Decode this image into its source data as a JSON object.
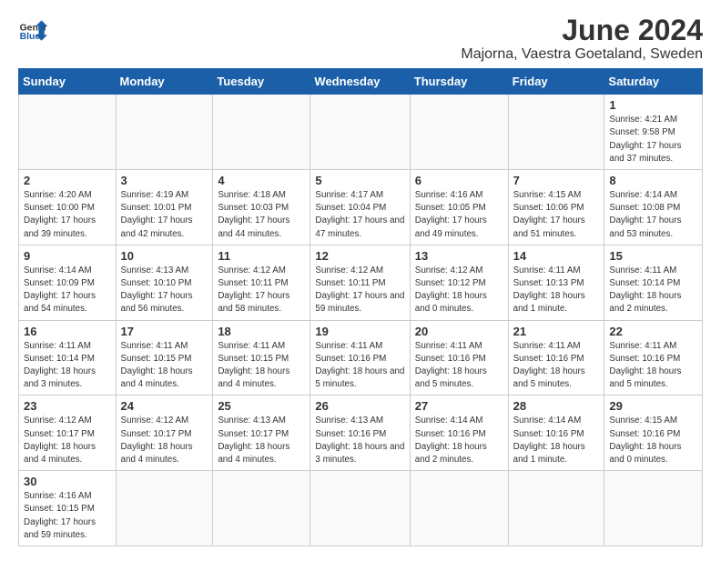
{
  "header": {
    "logo_general": "General",
    "logo_blue": "Blue",
    "month": "June 2024",
    "location": "Majorna, Vaestra Goetaland, Sweden"
  },
  "weekdays": [
    "Sunday",
    "Monday",
    "Tuesday",
    "Wednesday",
    "Thursday",
    "Friday",
    "Saturday"
  ],
  "days": {
    "d1": {
      "num": "1",
      "rise": "Sunrise: 4:21 AM",
      "set": "Sunset: 9:58 PM",
      "day": "Daylight: 17 hours and 37 minutes."
    },
    "d2": {
      "num": "2",
      "rise": "Sunrise: 4:20 AM",
      "set": "Sunset: 10:00 PM",
      "day": "Daylight: 17 hours and 39 minutes."
    },
    "d3": {
      "num": "3",
      "rise": "Sunrise: 4:19 AM",
      "set": "Sunset: 10:01 PM",
      "day": "Daylight: 17 hours and 42 minutes."
    },
    "d4": {
      "num": "4",
      "rise": "Sunrise: 4:18 AM",
      "set": "Sunset: 10:03 PM",
      "day": "Daylight: 17 hours and 44 minutes."
    },
    "d5": {
      "num": "5",
      "rise": "Sunrise: 4:17 AM",
      "set": "Sunset: 10:04 PM",
      "day": "Daylight: 17 hours and 47 minutes."
    },
    "d6": {
      "num": "6",
      "rise": "Sunrise: 4:16 AM",
      "set": "Sunset: 10:05 PM",
      "day": "Daylight: 17 hours and 49 minutes."
    },
    "d7": {
      "num": "7",
      "rise": "Sunrise: 4:15 AM",
      "set": "Sunset: 10:06 PM",
      "day": "Daylight: 17 hours and 51 minutes."
    },
    "d8": {
      "num": "8",
      "rise": "Sunrise: 4:14 AM",
      "set": "Sunset: 10:08 PM",
      "day": "Daylight: 17 hours and 53 minutes."
    },
    "d9": {
      "num": "9",
      "rise": "Sunrise: 4:14 AM",
      "set": "Sunset: 10:09 PM",
      "day": "Daylight: 17 hours and 54 minutes."
    },
    "d10": {
      "num": "10",
      "rise": "Sunrise: 4:13 AM",
      "set": "Sunset: 10:10 PM",
      "day": "Daylight: 17 hours and 56 minutes."
    },
    "d11": {
      "num": "11",
      "rise": "Sunrise: 4:12 AM",
      "set": "Sunset: 10:11 PM",
      "day": "Daylight: 17 hours and 58 minutes."
    },
    "d12": {
      "num": "12",
      "rise": "Sunrise: 4:12 AM",
      "set": "Sunset: 10:11 PM",
      "day": "Daylight: 17 hours and 59 minutes."
    },
    "d13": {
      "num": "13",
      "rise": "Sunrise: 4:12 AM",
      "set": "Sunset: 10:12 PM",
      "day": "Daylight: 18 hours and 0 minutes."
    },
    "d14": {
      "num": "14",
      "rise": "Sunrise: 4:11 AM",
      "set": "Sunset: 10:13 PM",
      "day": "Daylight: 18 hours and 1 minute."
    },
    "d15": {
      "num": "15",
      "rise": "Sunrise: 4:11 AM",
      "set": "Sunset: 10:14 PM",
      "day": "Daylight: 18 hours and 2 minutes."
    },
    "d16": {
      "num": "16",
      "rise": "Sunrise: 4:11 AM",
      "set": "Sunset: 10:14 PM",
      "day": "Daylight: 18 hours and 3 minutes."
    },
    "d17": {
      "num": "17",
      "rise": "Sunrise: 4:11 AM",
      "set": "Sunset: 10:15 PM",
      "day": "Daylight: 18 hours and 4 minutes."
    },
    "d18": {
      "num": "18",
      "rise": "Sunrise: 4:11 AM",
      "set": "Sunset: 10:15 PM",
      "day": "Daylight: 18 hours and 4 minutes."
    },
    "d19": {
      "num": "19",
      "rise": "Sunrise: 4:11 AM",
      "set": "Sunset: 10:16 PM",
      "day": "Daylight: 18 hours and 5 minutes."
    },
    "d20": {
      "num": "20",
      "rise": "Sunrise: 4:11 AM",
      "set": "Sunset: 10:16 PM",
      "day": "Daylight: 18 hours and 5 minutes."
    },
    "d21": {
      "num": "21",
      "rise": "Sunrise: 4:11 AM",
      "set": "Sunset: 10:16 PM",
      "day": "Daylight: 18 hours and 5 minutes."
    },
    "d22": {
      "num": "22",
      "rise": "Sunrise: 4:11 AM",
      "set": "Sunset: 10:16 PM",
      "day": "Daylight: 18 hours and 5 minutes."
    },
    "d23": {
      "num": "23",
      "rise": "Sunrise: 4:12 AM",
      "set": "Sunset: 10:17 PM",
      "day": "Daylight: 18 hours and 4 minutes."
    },
    "d24": {
      "num": "24",
      "rise": "Sunrise: 4:12 AM",
      "set": "Sunset: 10:17 PM",
      "day": "Daylight: 18 hours and 4 minutes."
    },
    "d25": {
      "num": "25",
      "rise": "Sunrise: 4:13 AM",
      "set": "Sunset: 10:17 PM",
      "day": "Daylight: 18 hours and 4 minutes."
    },
    "d26": {
      "num": "26",
      "rise": "Sunrise: 4:13 AM",
      "set": "Sunset: 10:16 PM",
      "day": "Daylight: 18 hours and 3 minutes."
    },
    "d27": {
      "num": "27",
      "rise": "Sunrise: 4:14 AM",
      "set": "Sunset: 10:16 PM",
      "day": "Daylight: 18 hours and 2 minutes."
    },
    "d28": {
      "num": "28",
      "rise": "Sunrise: 4:14 AM",
      "set": "Sunset: 10:16 PM",
      "day": "Daylight: 18 hours and 1 minute."
    },
    "d29": {
      "num": "29",
      "rise": "Sunrise: 4:15 AM",
      "set": "Sunset: 10:16 PM",
      "day": "Daylight: 18 hours and 0 minutes."
    },
    "d30": {
      "num": "30",
      "rise": "Sunrise: 4:16 AM",
      "set": "Sunset: 10:15 PM",
      "day": "Daylight: 17 hours and 59 minutes."
    }
  }
}
